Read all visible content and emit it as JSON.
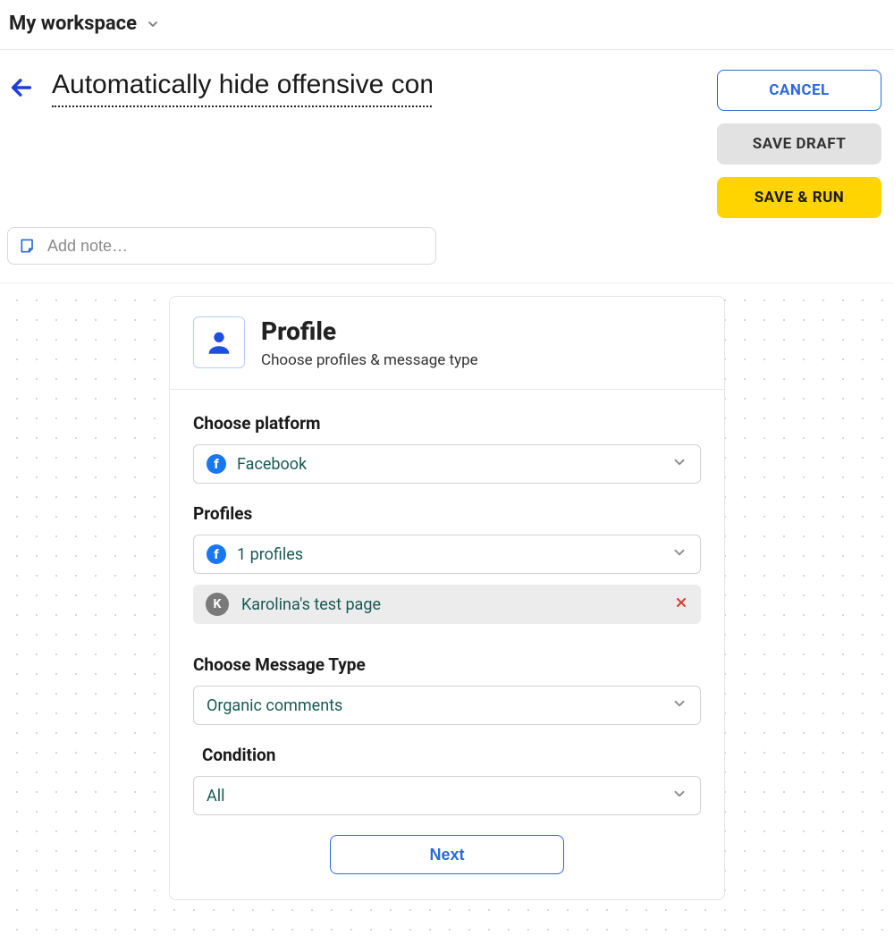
{
  "topbar": {
    "workspace_name": "My workspace"
  },
  "header": {
    "title_value": "Automatically hide offensive com",
    "actions": {
      "cancel": "CANCEL",
      "save_draft": "SAVE DRAFT",
      "save_run": "SAVE & RUN"
    }
  },
  "note": {
    "placeholder": "Add note…"
  },
  "card": {
    "title": "Profile",
    "subtitle": "Choose profiles & message type",
    "platform": {
      "label": "Choose platform",
      "value": "Facebook",
      "icon": "facebook"
    },
    "profiles": {
      "label": "Profiles",
      "value": "1 profiles",
      "selected": [
        {
          "avatar_letter": "K",
          "name": "Karolina's test page"
        }
      ]
    },
    "message_type": {
      "label": "Choose Message Type",
      "value": "Organic comments"
    },
    "condition": {
      "label": "Condition",
      "value": "All"
    },
    "next_label": "Next"
  }
}
